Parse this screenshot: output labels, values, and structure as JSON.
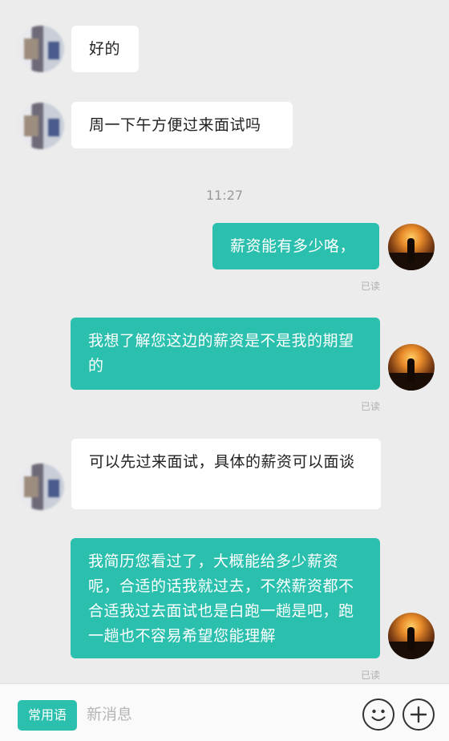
{
  "messages": [
    {
      "from": "other",
      "text": "好的"
    },
    {
      "from": "other",
      "text": "周一下午方便过来面试吗"
    },
    {
      "from": "me",
      "text": "薪资能有多少咯，",
      "status": "已读"
    },
    {
      "from": "me",
      "text": "我想了解您这边的薪资是不是我的期望的",
      "status": "已读"
    },
    {
      "from": "other",
      "text": "可以先过来面试，具体的薪资可以面谈"
    },
    {
      "from": "me",
      "text": "我简历您看过了，大概能给多少薪资呢，合适的话我就过去，不然薪资都不合适我过去面试也是白跑一趟是吧，跑一趟也不容易希望您能理解",
      "status": "已读"
    }
  ],
  "timestamp": "11:27",
  "composer": {
    "quick_phrases_label": "常用语",
    "input_placeholder": "新消息",
    "emoji_icon": "smiley-icon",
    "plus_icon": "plus-icon"
  },
  "colors": {
    "accent": "#2bbfae",
    "background": "#ececec",
    "incoming_bubble": "#ffffff"
  }
}
